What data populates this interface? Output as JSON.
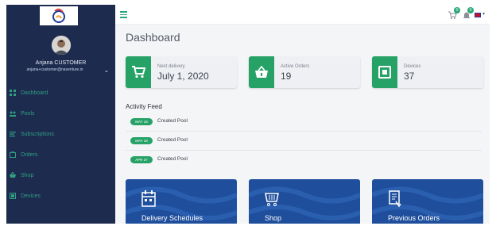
{
  "sidebar": {
    "user_name": "Anjana CUSTOMER",
    "user_email": "anjana+customer@naventure.in",
    "items": [
      {
        "label": "Dashboard",
        "icon": "dashboard-icon"
      },
      {
        "label": "Pools",
        "icon": "pools-icon"
      },
      {
        "label": "Subscriptions",
        "icon": "subscriptions-icon"
      },
      {
        "label": "Orders",
        "icon": "orders-icon"
      },
      {
        "label": "Shop",
        "icon": "shop-icon"
      },
      {
        "label": "Devices",
        "icon": "devices-icon"
      }
    ]
  },
  "topbar": {
    "cart_badge": "0",
    "notifications_badge": "0"
  },
  "main": {
    "title": "Dashboard",
    "stats": [
      {
        "label": "Next delivery",
        "value": "July 1, 2020",
        "icon": "cart-icon"
      },
      {
        "label": "Active Orders",
        "value": "19",
        "icon": "basket-icon"
      },
      {
        "label": "Devices",
        "value": "37",
        "icon": "device-icon"
      }
    ],
    "feed_title": "Activity Feed",
    "feed": [
      {
        "badge": "MAY 18",
        "text": "Created Pool"
      },
      {
        "badge": "MAY 18",
        "text": "Created Pool"
      },
      {
        "badge": "APR 27",
        "text": "Created Pool"
      }
    ],
    "actions": [
      {
        "label": "Delivery Schedules",
        "icon": "calendar-icon"
      },
      {
        "label": "Shop",
        "icon": "shop-cart-icon"
      },
      {
        "label": "Previous Orders",
        "icon": "receipt-icon"
      }
    ]
  },
  "colors": {
    "sidebar_bg": "#1d2b4f",
    "accent_green": "#26a267",
    "nav_text": "#2f9f82",
    "action_blue": "#1f4f9c"
  }
}
